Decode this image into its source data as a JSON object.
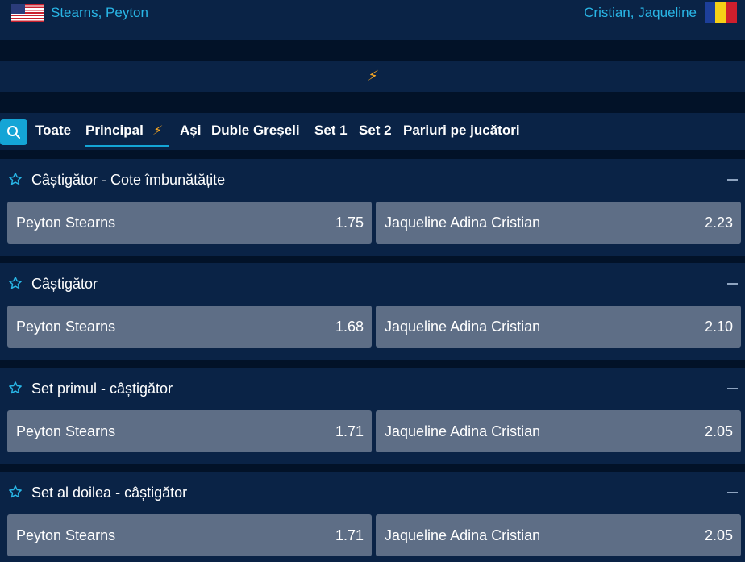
{
  "match": {
    "home": {
      "name": "Stearns, Peyton",
      "flag_icon": "us-flag-icon"
    },
    "away": {
      "name": "Cristian, Jaqueline",
      "flag_icon": "romania-flag-icon"
    }
  },
  "colors": {
    "background": "#021228",
    "panel": "#0a2346",
    "accent": "#14a5d6",
    "team_name": "#29b6e6",
    "odd_button": "#5e6e86",
    "boost": "#f5a623"
  },
  "boost_icon": "lightning-bolt-icon",
  "search_icon": "search-icon",
  "tabs": [
    {
      "label": "Toate",
      "active": false
    },
    {
      "label": "Principal",
      "active": true,
      "icon": "lightning-bolt-icon"
    },
    {
      "label": "Ași",
      "active": false
    },
    {
      "label": "Duble Greșeli",
      "active": false
    },
    {
      "label": "Set 1",
      "active": false
    },
    {
      "label": "Set 2",
      "active": false
    },
    {
      "label": "Pariuri pe jucători",
      "active": false
    }
  ],
  "markets": [
    {
      "title": "Câștigător - Cote îmbunătățite",
      "odds": [
        {
          "name": "Peyton Stearns",
          "price": "1.75"
        },
        {
          "name": "Jaqueline Adina Cristian",
          "price": "2.23"
        }
      ]
    },
    {
      "title": "Câștigător",
      "odds": [
        {
          "name": "Peyton Stearns",
          "price": "1.68"
        },
        {
          "name": "Jaqueline Adina Cristian",
          "price": "2.10"
        }
      ]
    },
    {
      "title": "Set primul - câștigător",
      "odds": [
        {
          "name": "Peyton Stearns",
          "price": "1.71"
        },
        {
          "name": "Jaqueline Adina Cristian",
          "price": "2.05"
        }
      ]
    },
    {
      "title": "Set al doilea - câștigător",
      "odds": [
        {
          "name": "Peyton Stearns",
          "price": "1.71"
        },
        {
          "name": "Jaqueline Adina Cristian",
          "price": "2.05"
        }
      ]
    }
  ]
}
